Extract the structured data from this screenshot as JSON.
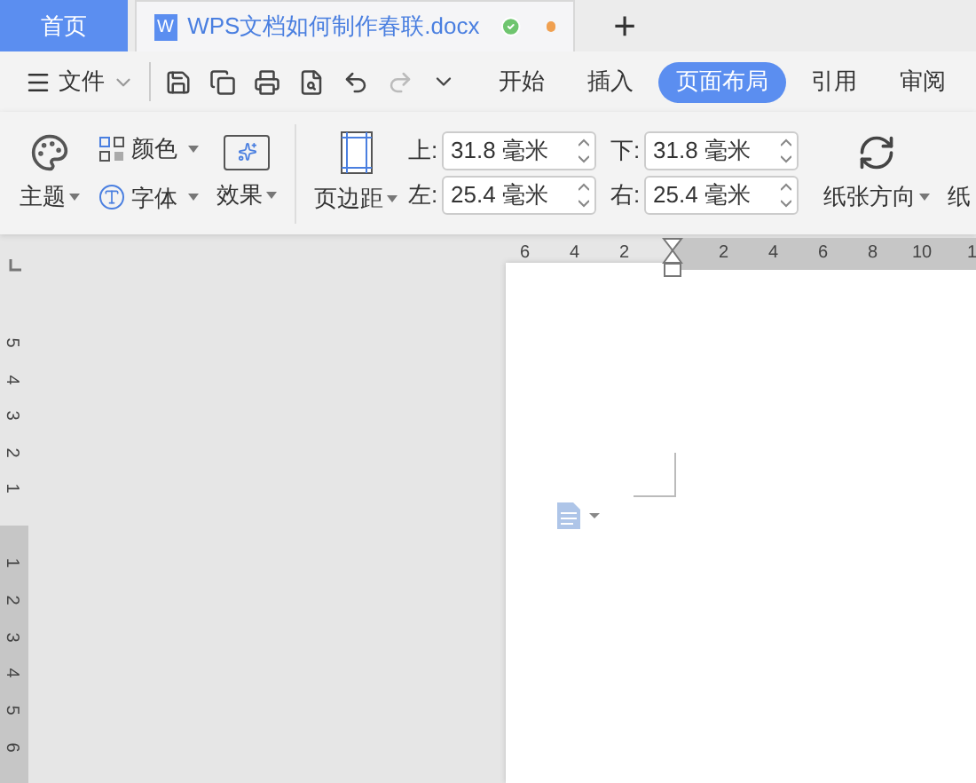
{
  "tabs": [
    {
      "label": "首页",
      "kind": "home",
      "selected": false
    },
    {
      "label": "WPS文档如何制作春联.docx",
      "kind": "doc",
      "selected": true,
      "icon_letter": "W",
      "saved": true,
      "modified": true
    }
  ],
  "new_tab": "+",
  "toolbar": {
    "file_menu": "文件",
    "ribbon_tabs": [
      {
        "label": "开始",
        "selected": false
      },
      {
        "label": "插入",
        "selected": false
      },
      {
        "label": "页面布局",
        "selected": true
      },
      {
        "label": "引用",
        "selected": false
      },
      {
        "label": "审阅",
        "selected": false
      }
    ]
  },
  "ribbon": {
    "theme": "主题",
    "colors": "颜色",
    "fonts": "字体",
    "effects": "效果",
    "margins": "页边距",
    "margin_fields": [
      {
        "label": "上:",
        "value": "31.8 毫米"
      },
      {
        "label": "下:",
        "value": "31.8 毫米"
      },
      {
        "label": "左:",
        "value": "25.4 毫米"
      },
      {
        "label": "右:",
        "value": "25.4 毫米"
      }
    ],
    "orientation": "纸张方向",
    "size": "纸"
  },
  "horizontal_ruler": [
    "6",
    "4",
    "2",
    "2",
    "4",
    "6",
    "8",
    "10",
    "1"
  ],
  "vertical_ruler": [
    "5",
    "4",
    "3",
    "2",
    "1",
    "1",
    "2",
    "3",
    "4",
    "5",
    "6"
  ]
}
